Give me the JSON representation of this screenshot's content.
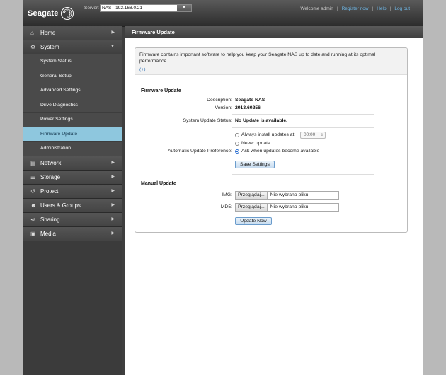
{
  "header": {
    "brand": "Seagate",
    "server_label": "Server:",
    "server_value": "NAS - 192.168.0.21",
    "welcome": "Welcome admin",
    "register": "Register now",
    "help": "Help",
    "logout": "Log out",
    "sep": "|"
  },
  "sidebar": {
    "items": [
      {
        "label": "Home",
        "icon": "home-icon"
      },
      {
        "label": "System",
        "icon": "system-icon"
      },
      {
        "label": "Network",
        "icon": "network-icon"
      },
      {
        "label": "Storage",
        "icon": "storage-icon"
      },
      {
        "label": "Protect",
        "icon": "protect-icon"
      },
      {
        "label": "Users & Groups",
        "icon": "users-icon"
      },
      {
        "label": "Sharing",
        "icon": "sharing-icon"
      },
      {
        "label": "Media",
        "icon": "media-icon"
      }
    ],
    "system_sub": [
      "System Status",
      "General Setup",
      "Advanced Settings",
      "Drive Diagnostics",
      "Power Settings",
      "Firmware Update",
      "Administration"
    ]
  },
  "main": {
    "title": "Firmware Update",
    "intro": "Firmware contains important software to help you keep your Seagate NAS up to date and running at its optimal performance.",
    "more": "(+)",
    "fw_section": "Firmware Update",
    "desc_label": "Description:",
    "desc_value": "Seagate NAS",
    "ver_label": "Version:",
    "ver_value": "2013.60256",
    "status_label": "System Update Status:",
    "status_value": "No Update is available.",
    "pref_label": "Automatic Update Preference:",
    "opt_always": "Always install updates at",
    "opt_time": "00:00",
    "opt_never": "Never update",
    "opt_ask": "Ask when updates become available",
    "save_btn": "Save Settings",
    "manual_section": "Manual Update",
    "img_label": "IMG:",
    "md5_label": "MD5:",
    "browse_btn": "Przeglądaj...",
    "no_file": "Nie wybrano pliku.",
    "update_btn": "Update Now"
  },
  "colors": {
    "active_sub": "#8ec7de",
    "link": "#6fb8e8"
  }
}
